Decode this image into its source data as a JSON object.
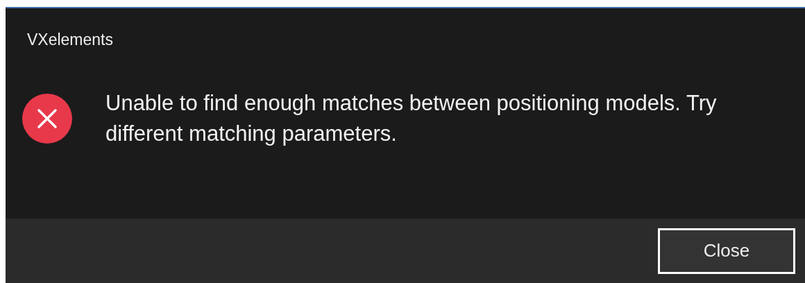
{
  "dialog": {
    "title": "VXelements",
    "icon": {
      "kind": "error"
    },
    "message": "Unable to find enough matches between positioning models. Try different matching parameters.",
    "buttons": [
      {
        "label": "Close",
        "focused": true
      }
    ]
  }
}
